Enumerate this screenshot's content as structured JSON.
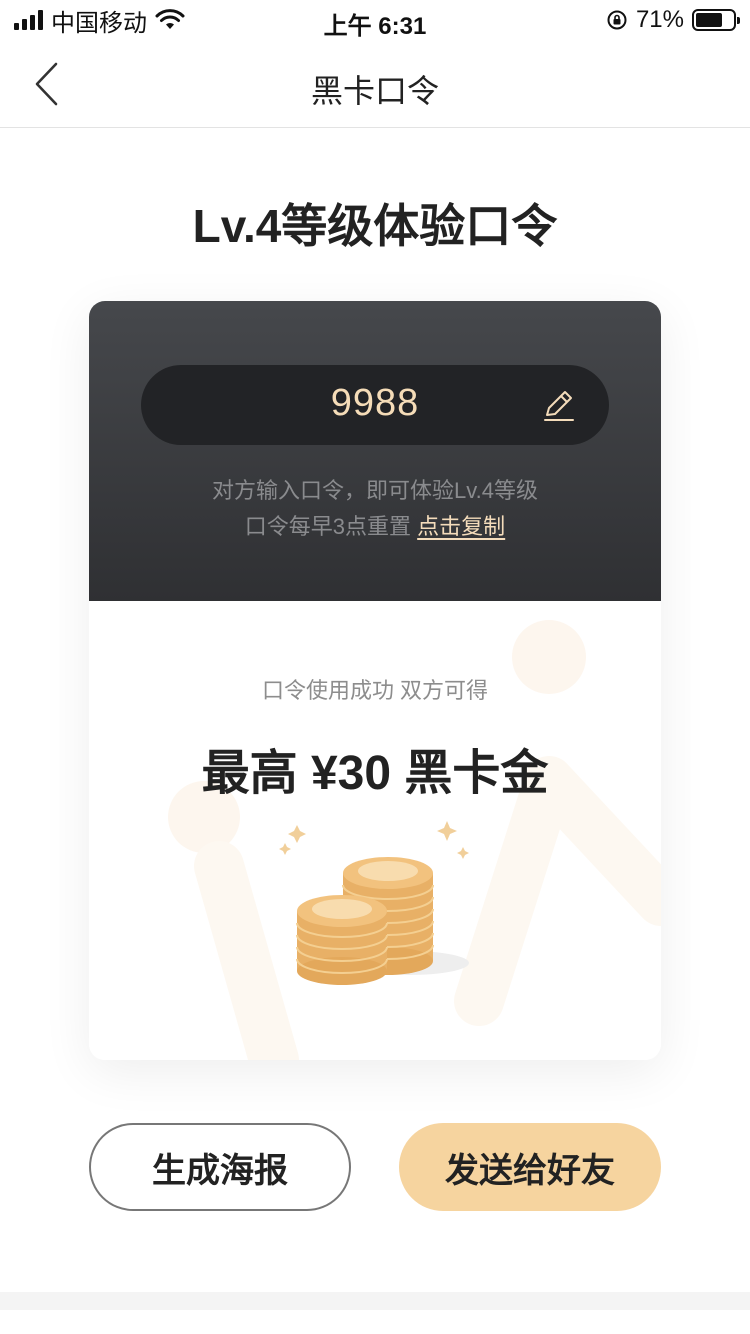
{
  "status_bar": {
    "carrier": "中国移动",
    "time": "上午 6:31",
    "battery": "71%",
    "battery_level": 0.71,
    "icons": [
      "signal-icon",
      "wifi-icon",
      "rotation-lock-icon",
      "battery-icon"
    ]
  },
  "nav": {
    "title": "黑卡口令",
    "back_icon": "chevron-left-icon"
  },
  "page_title": "Lv.4等级体验口令",
  "card": {
    "code": "9988",
    "edit_icon": "pencil-icon",
    "desc_line1": "对方输入口令，即可体验Lv.4等级",
    "desc_line2": "口令每早3点重置",
    "copy_link": "点击复制",
    "reward_note": "口令使用成功 双方可得",
    "reward_amount": "最高 ¥30 黑卡金",
    "illustration": "gold-coins-icon"
  },
  "actions": {
    "poster": "生成海报",
    "send": "发送给好友"
  },
  "colors": {
    "card_dark": "#3a3b3f",
    "code_text": "#f5dcb8",
    "accent_button": "#f6d49f"
  }
}
